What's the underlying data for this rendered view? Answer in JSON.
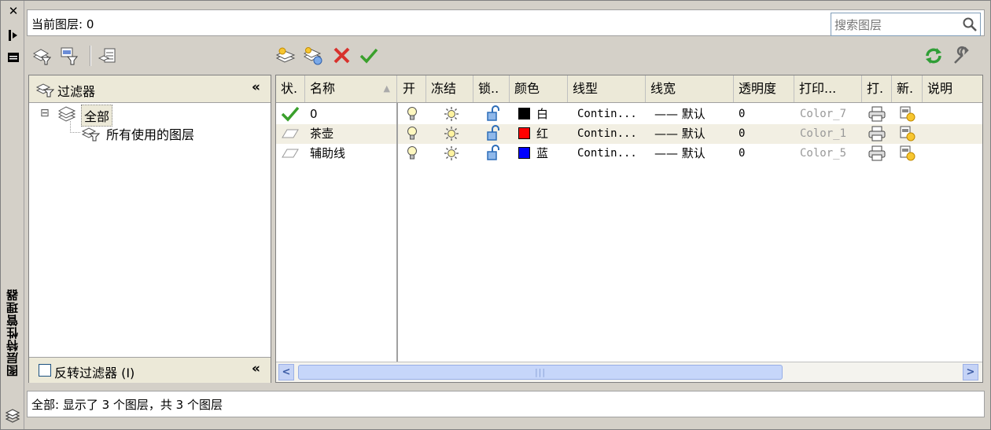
{
  "palette": "Layer Properties Manager",
  "strip": {
    "title": "图层特性管理器",
    "close_glyph": "✕"
  },
  "current_layer": {
    "label": "当前图层: 0"
  },
  "search": {
    "placeholder": "搜索图层"
  },
  "toolbar": {
    "left_icons": [
      "new-property-filter-icon",
      "new-group-filter-icon",
      "layer-states-manager-icon"
    ],
    "center_icons": [
      "new-layer-icon",
      "new-layer-vp-frozen-icon",
      "delete-layer-icon",
      "set-current-icon"
    ],
    "right_icons": [
      "refresh-icon",
      "settings-icon"
    ]
  },
  "filters": {
    "header": "过滤器",
    "collapse_glyph": "«",
    "expander_glyph": "⊟",
    "tree": [
      {
        "label": "全部",
        "level": 0,
        "selected": true
      },
      {
        "label": "所有使用的图层",
        "level": 1,
        "selected": false
      }
    ],
    "invert_label": "反转过滤器 (I)",
    "invert_checked": false
  },
  "grid": {
    "columns": [
      "状.",
      "名称",
      "开",
      "冻结",
      "锁..",
      "颜色",
      "线型",
      "线宽",
      "透明度",
      "打印...",
      "打.",
      "新.",
      "说明"
    ],
    "rows": [
      {
        "status": "current",
        "name": "0",
        "on": true,
        "frozen": false,
        "locked": false,
        "color_name": "白",
        "color_hex": "#000000",
        "linetype": "Contin...",
        "lineweight": "—— 默认",
        "transparency": "0",
        "plot_style": "Color_7"
      },
      {
        "status": "normal",
        "name": "茶壶",
        "on": true,
        "frozen": false,
        "locked": false,
        "color_name": "红",
        "color_hex": "#ff0000",
        "linetype": "Contin...",
        "lineweight": "—— 默认",
        "transparency": "0",
        "plot_style": "Color_1"
      },
      {
        "status": "normal",
        "name": "辅助线",
        "on": true,
        "frozen": false,
        "locked": false,
        "color_name": "蓝",
        "color_hex": "#0000ff",
        "linetype": "Contin...",
        "lineweight": "—— 默认",
        "transparency": "0",
        "plot_style": "Color_5"
      }
    ],
    "scroll_left": "<",
    "scroll_right": ">",
    "thumb_grip": "|||"
  },
  "status_bar": {
    "text": "全部: 显示了 3 个图层，共 3 个图层"
  }
}
